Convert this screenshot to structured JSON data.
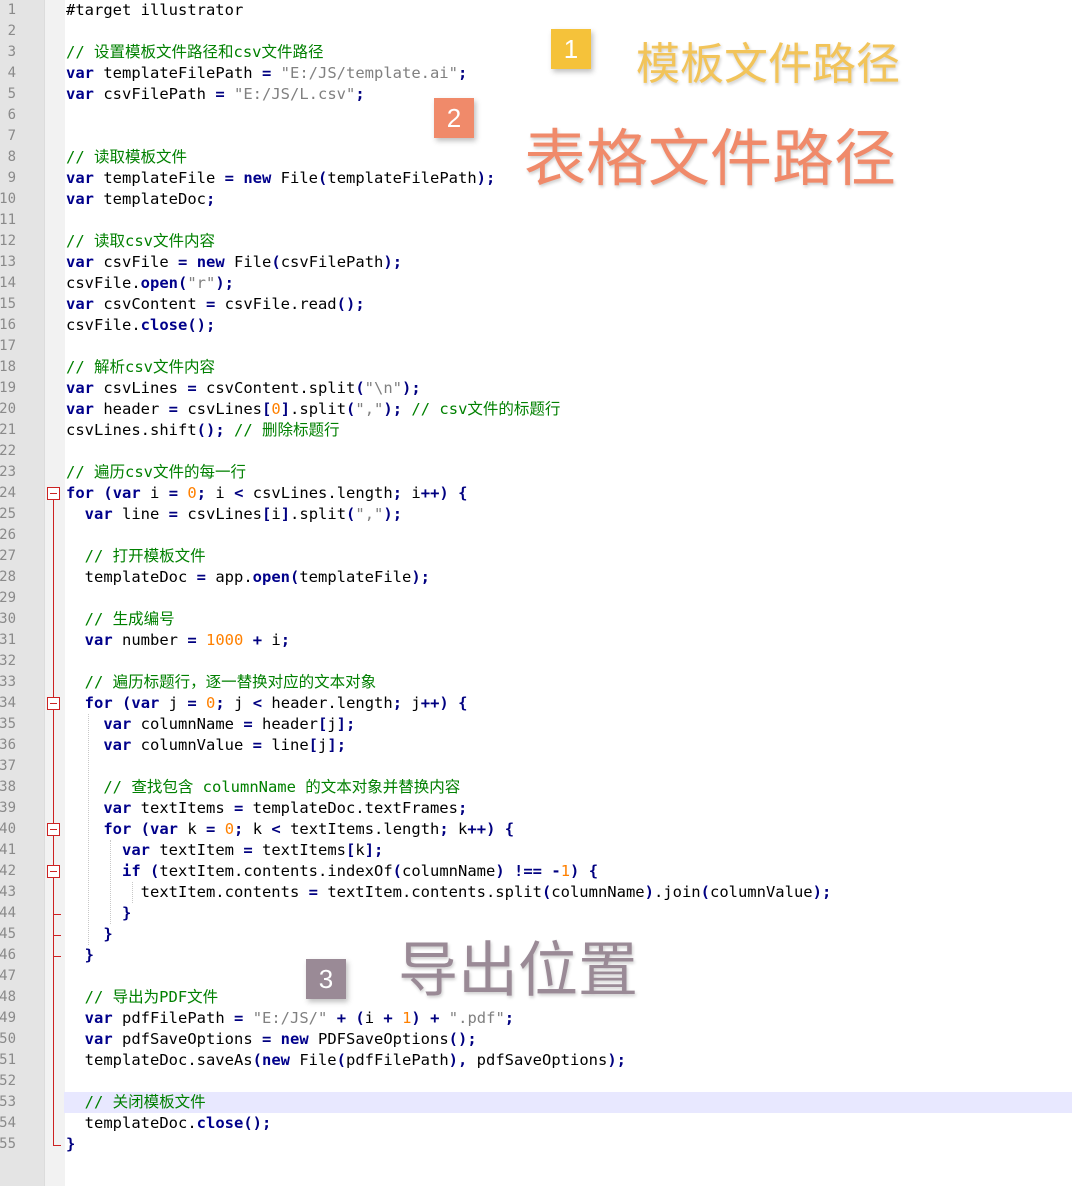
{
  "colors": {
    "keyword": "#00008b",
    "string": "#808080",
    "number": "#ff8000",
    "comment": "#008000",
    "fold_marker": "#cc2222",
    "current_line": "#e8e8ff",
    "badge_1": "#f5c23a",
    "badge_2": "#f08a6a",
    "badge_3": "#9a8a96"
  },
  "icons": {
    "fold": "fold-minus-icon"
  },
  "editor": {
    "current_line": 53,
    "lines": [
      {
        "n": "1",
        "code": "#target illustrator"
      },
      {
        "n": "2",
        "code": ""
      },
      {
        "n": "3",
        "code": "// 设置模板文件路径和csv文件路径"
      },
      {
        "n": "4",
        "code": "var templateFilePath = \"E:/JS/template.ai\";"
      },
      {
        "n": "5",
        "code": "var csvFilePath = \"E:/JS/L.csv\";"
      },
      {
        "n": "6",
        "code": ""
      },
      {
        "n": "7",
        "code": ""
      },
      {
        "n": "8",
        "code": "// 读取模板文件"
      },
      {
        "n": "9",
        "code": "var templateFile = new File(templateFilePath);"
      },
      {
        "n": "10",
        "code": "var templateDoc;"
      },
      {
        "n": "11",
        "code": ""
      },
      {
        "n": "12",
        "code": "// 读取csv文件内容"
      },
      {
        "n": "13",
        "code": "var csvFile = new File(csvFilePath);"
      },
      {
        "n": "14",
        "code": "csvFile.open(\"r\");"
      },
      {
        "n": "15",
        "code": "var csvContent = csvFile.read();"
      },
      {
        "n": "16",
        "code": "csvFile.close();"
      },
      {
        "n": "17",
        "code": ""
      },
      {
        "n": "18",
        "code": "// 解析csv文件内容"
      },
      {
        "n": "19",
        "code": "var csvLines = csvContent.split(\"\\n\");"
      },
      {
        "n": "20",
        "code": "var header = csvLines[0].split(\",\"); // csv文件的标题行"
      },
      {
        "n": "21",
        "code": "csvLines.shift(); // 删除标题行"
      },
      {
        "n": "22",
        "code": ""
      },
      {
        "n": "23",
        "code": "// 遍历csv文件的每一行"
      },
      {
        "n": "24",
        "code": "for (var i = 0; i < csvLines.length; i++) {"
      },
      {
        "n": "25",
        "code": "  var line = csvLines[i].split(\",\");"
      },
      {
        "n": "26",
        "code": ""
      },
      {
        "n": "27",
        "code": "  // 打开模板文件"
      },
      {
        "n": "28",
        "code": "  templateDoc = app.open(templateFile);"
      },
      {
        "n": "29",
        "code": ""
      },
      {
        "n": "30",
        "code": "  // 生成编号"
      },
      {
        "n": "31",
        "code": "  var number = 1000 + i;"
      },
      {
        "n": "32",
        "code": ""
      },
      {
        "n": "33",
        "code": "  // 遍历标题行，逐一替换对应的文本对象"
      },
      {
        "n": "34",
        "code": "  for (var j = 0; j < header.length; j++) {"
      },
      {
        "n": "35",
        "code": "    var columnName = header[j];"
      },
      {
        "n": "36",
        "code": "    var columnValue = line[j];"
      },
      {
        "n": "37",
        "code": ""
      },
      {
        "n": "38",
        "code": "    // 查找包含 columnName 的文本对象并替换内容"
      },
      {
        "n": "39",
        "code": "    var textItems = templateDoc.textFrames;"
      },
      {
        "n": "40",
        "code": "    for (var k = 0; k < textItems.length; k++) {"
      },
      {
        "n": "41",
        "code": "      var textItem = textItems[k];"
      },
      {
        "n": "42",
        "code": "      if (textItem.contents.indexOf(columnName) !== -1) {"
      },
      {
        "n": "43",
        "code": "        textItem.contents = textItem.contents.split(columnName).join(columnValue);"
      },
      {
        "n": "44",
        "code": "      }"
      },
      {
        "n": "45",
        "code": "    }"
      },
      {
        "n": "46",
        "code": "  }"
      },
      {
        "n": "47",
        "code": ""
      },
      {
        "n": "48",
        "code": "  // 导出为PDF文件"
      },
      {
        "n": "49",
        "code": "  var pdfFilePath = \"E:/JS/\" + (i + 1) + \".pdf\";"
      },
      {
        "n": "50",
        "code": "  var pdfSaveOptions = new PDFSaveOptions();"
      },
      {
        "n": "51",
        "code": "  templateDoc.saveAs(new File(pdfFilePath), pdfSaveOptions);"
      },
      {
        "n": "52",
        "code": ""
      },
      {
        "n": "53",
        "code": "  // 关闭模板文件"
      },
      {
        "n": "54",
        "code": "  templateDoc.close();"
      },
      {
        "n": "55",
        "code": "}"
      }
    ]
  },
  "annotations": [
    {
      "badge": "1",
      "label": "模板文件路径"
    },
    {
      "badge": "2",
      "label": "表格文件路径"
    },
    {
      "badge": "3",
      "label": "导出位置"
    }
  ]
}
